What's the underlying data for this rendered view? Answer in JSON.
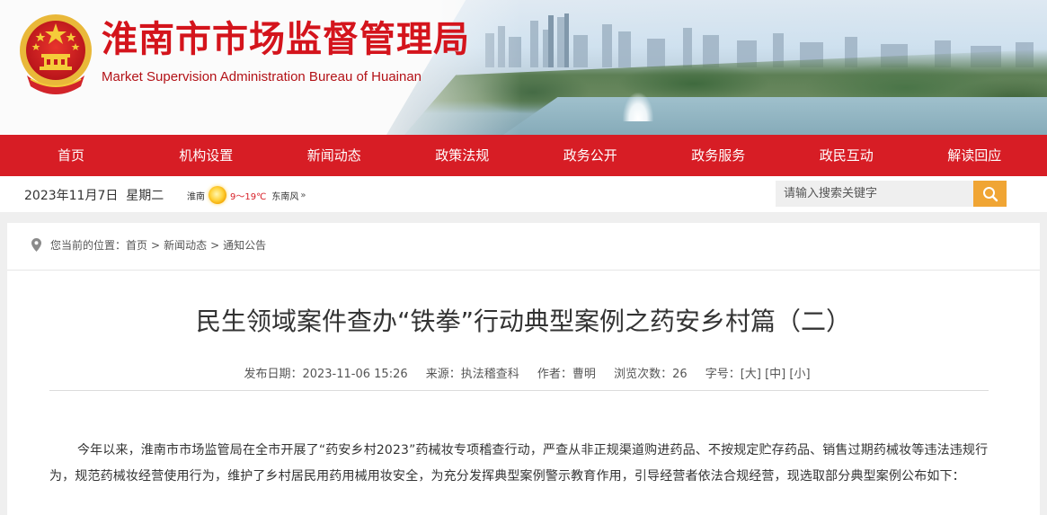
{
  "header": {
    "title": "淮南市市场监督管理局",
    "subtitle": "Market Supervision Administration Bureau of Huainan"
  },
  "nav": {
    "items": [
      "首页",
      "机构设置",
      "新闻动态",
      "政策法规",
      "政务公开",
      "政务服务",
      "政民互动",
      "解读回应"
    ]
  },
  "infobar": {
    "date": "2023年11月7日",
    "weekday": "星期二",
    "weather": {
      "city": "淮南",
      "temp": "9～19℃",
      "wind": "东南风",
      "icon": "sun-icon"
    }
  },
  "search": {
    "placeholder": "请输入搜索关键字",
    "icon": "search-icon"
  },
  "breadcrumb": {
    "prefix": "您当前的位置：",
    "items": [
      "首页",
      "新闻动态",
      "通知公告"
    ],
    "separator": ">"
  },
  "article": {
    "title": "民生领域案件查办“铁拳”行动典型案例之药安乡村篇（二）",
    "meta": {
      "date": "发布日期：2023-11-06 15:26",
      "source": "来源：执法稽查科",
      "author": "作者：曹明",
      "views": "浏览次数：26",
      "fontsize_label": "字号：",
      "sizes": [
        "[大]",
        "[中]",
        "[小]"
      ]
    },
    "body": "今年以来，淮南市市场监管局在全市开展了“药安乡村2023”药械妆专项稽查行动，严查从非正规渠道购进药品、不按规定贮存药品、销售过期药械妆等违法违规行为，规范药械妆经营使用行为，维护了乡村居民用药用械用妆安全，为充分发挥典型案例警示教育作用，引导经营者依法合规经营，现选取部分典型案例公布如下："
  },
  "colors": {
    "brand_red": "#d71d25",
    "title_red": "#d4141c",
    "search_orange": "#f0a534",
    "temp_red": "#d71d25"
  }
}
